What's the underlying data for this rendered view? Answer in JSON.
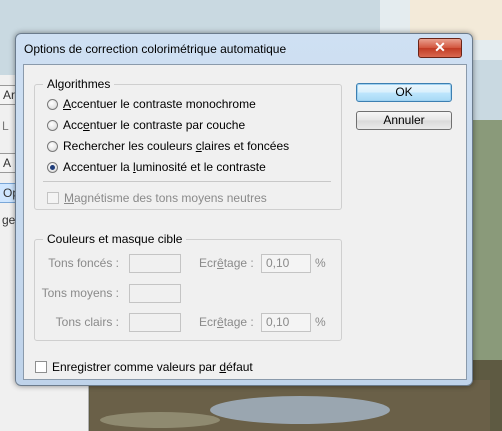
{
  "dialog": {
    "title": "Options de correction colorimétrique automatique",
    "close_glyph": "✕"
  },
  "algorithms": {
    "legend": "Algorithmes",
    "options": [
      {
        "pre": "",
        "acc": "A",
        "post": "ccentuer le contraste monochrome",
        "checked": false
      },
      {
        "pre": "Acc",
        "acc": "e",
        "post": "ntuer le contraste par couche",
        "checked": false
      },
      {
        "pre": "Rechercher les couleurs ",
        "acc": "c",
        "post": "laires et foncées",
        "checked": false
      },
      {
        "pre": "Accentuer la ",
        "acc": "l",
        "post": "uminosité et le contraste",
        "checked": true
      }
    ],
    "snap_pre": "",
    "snap_acc": "M",
    "snap_post": "agnétisme des tons moyens neutres"
  },
  "target": {
    "legend": "Couleurs et masque cible",
    "shadows_label": "Tons foncés :",
    "midtones_label": "Tons moyens :",
    "highlights_label": "Tons clairs :",
    "clip_label_shadows_pre": "Ecr",
    "clip_label_shadows_acc": "ê",
    "clip_label_shadows_post": "tage :",
    "clip_label_highlights_pre": "Ecr",
    "clip_label_highlights_acc": "ê",
    "clip_label_highlights_post": "tage :",
    "shadows_clip_value": "0,10",
    "highlights_clip_value": "0,10",
    "percent": "%"
  },
  "save_defaults": {
    "pre": "Enregistrer comme valeurs par ",
    "acc": "d",
    "post": "éfaut"
  },
  "buttons": {
    "ok": "OK",
    "cancel": "Annuler"
  },
  "background_fragments": [
    "Ar",
    "L",
    "A",
    "Opt",
    "ger"
  ]
}
